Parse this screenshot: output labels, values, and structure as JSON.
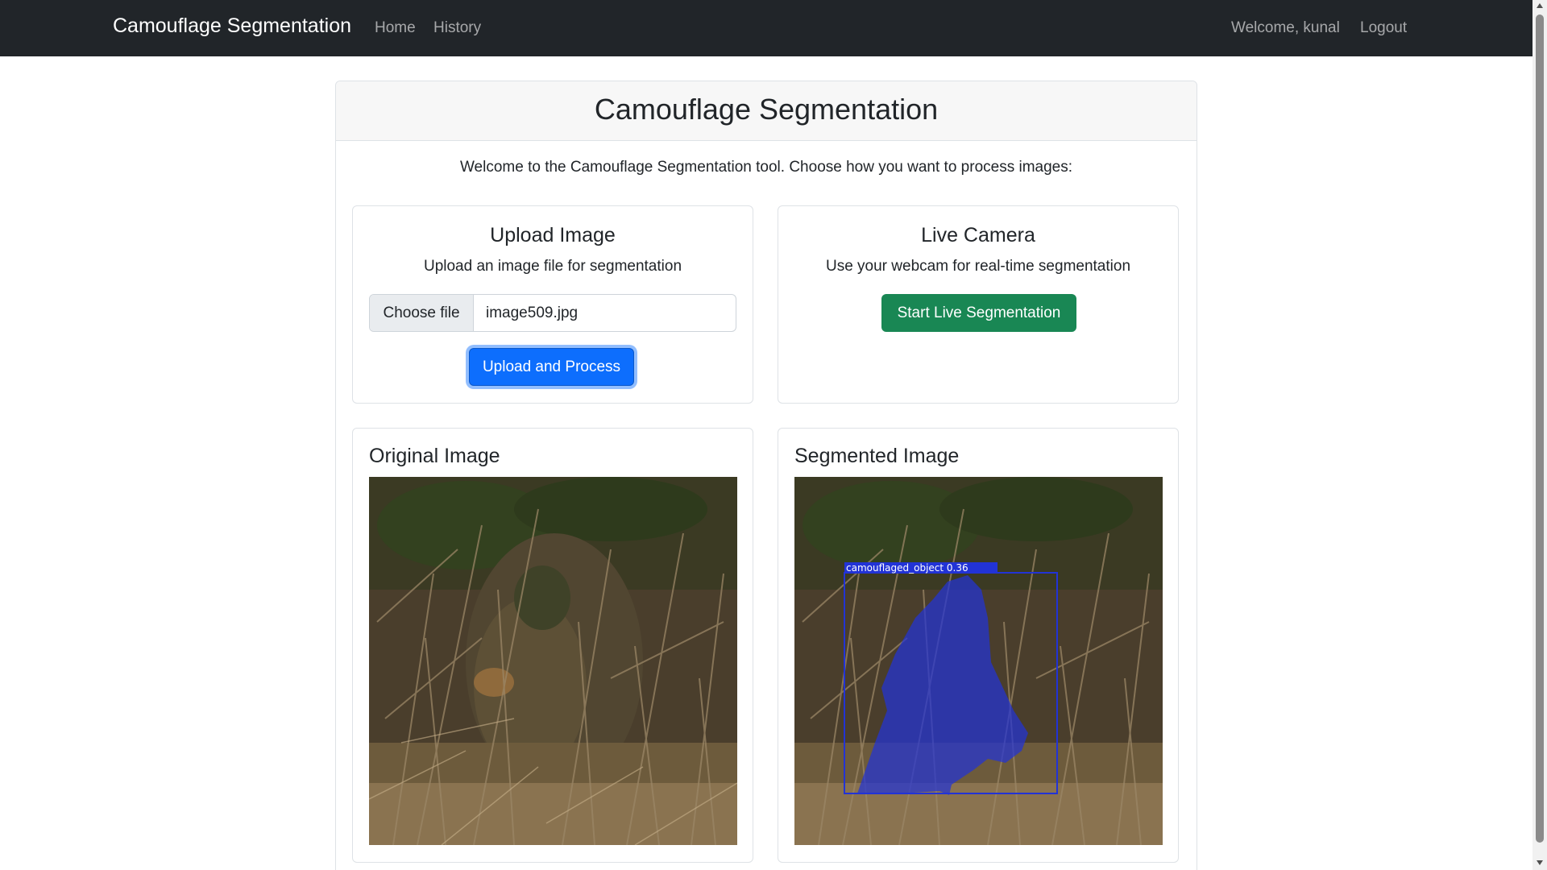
{
  "navbar": {
    "brand": "Camouflage Segmentation",
    "links": [
      {
        "label": "Home"
      },
      {
        "label": "History"
      }
    ],
    "welcome": "Welcome, kunal",
    "logout": "Logout"
  },
  "main": {
    "title": "Camouflage Segmentation",
    "intro": "Welcome to the Camouflage Segmentation tool. Choose how you want to process images:",
    "upload": {
      "title": "Upload Image",
      "description": "Upload an image file for segmentation",
      "choose_file_label": "Choose file",
      "file_name": "image509.jpg",
      "submit_label": "Upload and Process"
    },
    "live": {
      "title": "Live Camera",
      "description": "Use your webcam for real-time segmentation",
      "start_label": "Start Live Segmentation"
    },
    "original": {
      "title": "Original Image"
    },
    "segmented": {
      "title": "Segmented Image",
      "detection_label": "camouflaged_object  0.36"
    }
  },
  "colors": {
    "navbar": "#212529",
    "primary": "#0d6efd",
    "success": "#198754",
    "mask": "#2233d6"
  }
}
